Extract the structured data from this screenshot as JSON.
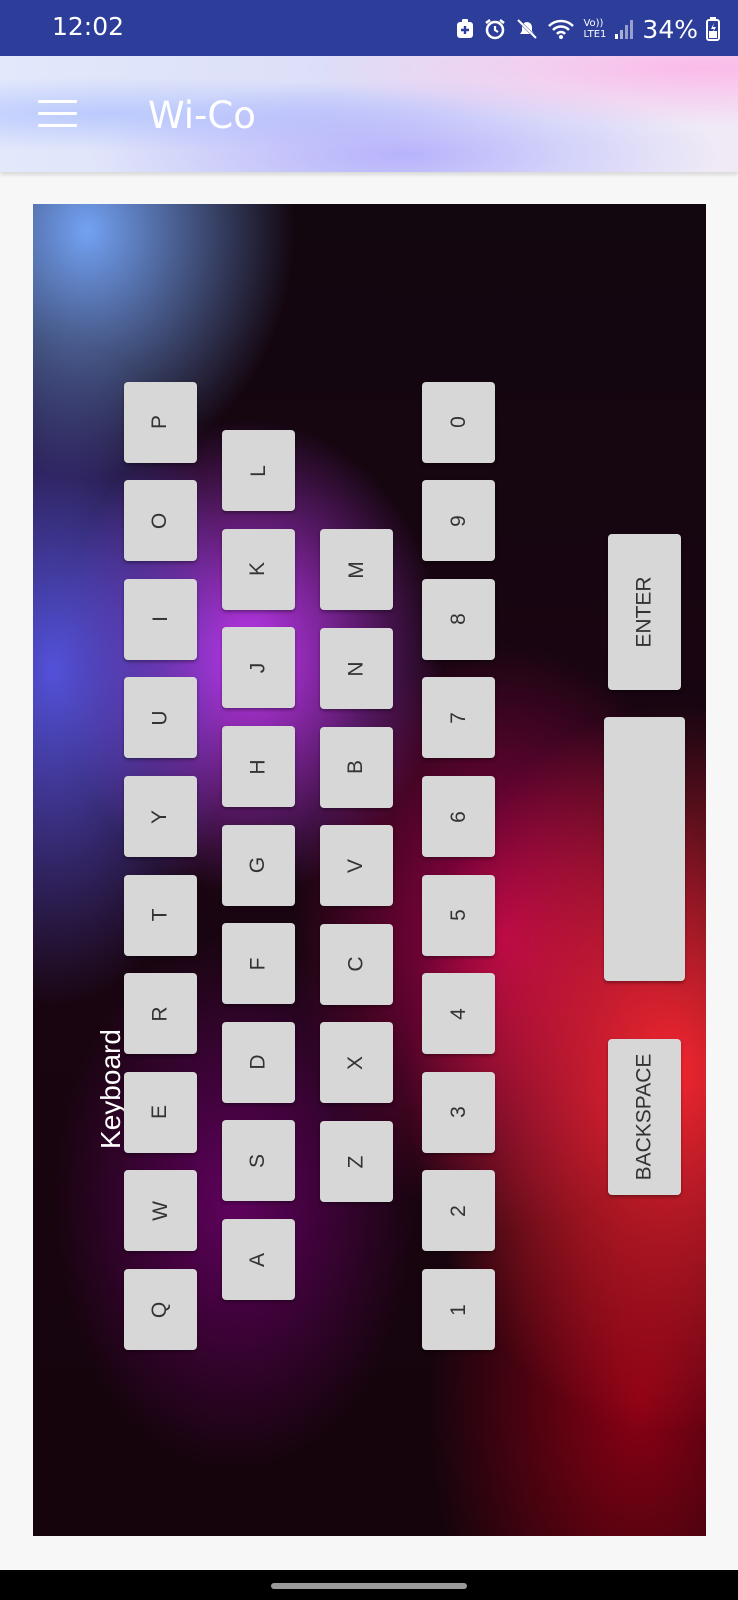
{
  "status_bar": {
    "time": "12:02",
    "battery": "34%",
    "icons": [
      "notification-icon",
      "alarm-icon",
      "mute-icon",
      "wifi-icon",
      "volte-icon",
      "signal-icon",
      "battery-charging-icon"
    ],
    "volte_label": "Vo))",
    "lte_label": "LTE1"
  },
  "app_bar": {
    "title": "Wi-Co",
    "menu_icon": "hamburger-menu-icon"
  },
  "keyboard": {
    "title": "Keyboard",
    "row_qwerty": [
      "Q",
      "W",
      "E",
      "R",
      "T",
      "Y",
      "U",
      "I",
      "O",
      "P"
    ],
    "row_asdf": [
      "A",
      "S",
      "D",
      "F",
      "G",
      "H",
      "J",
      "K",
      "L"
    ],
    "row_zxcv": [
      "Z",
      "X",
      "C",
      "V",
      "B",
      "N",
      "M"
    ],
    "row_numbers": [
      "1",
      "2",
      "3",
      "4",
      "5",
      "6",
      "7",
      "8",
      "9",
      "0"
    ],
    "enter_label": "ENTER",
    "space_label": "",
    "backspace_label": "BACKSPACE"
  },
  "colors": {
    "status_bar": "#2c3e9a",
    "key_face": "#d7d7d7",
    "key_text": "#333333"
  }
}
